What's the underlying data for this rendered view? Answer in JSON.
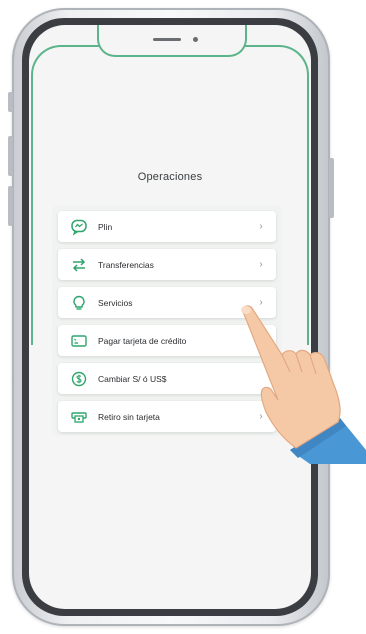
{
  "screen": {
    "title": "Operaciones"
  },
  "menu": {
    "items": [
      {
        "label": "Plin",
        "icon": "plin-chat-icon",
        "has_chevron": true
      },
      {
        "label": "Transferencias",
        "icon": "transfer-arrows-icon",
        "has_chevron": true
      },
      {
        "label": "Servicios",
        "icon": "lightbulb-icon",
        "has_chevron": true
      },
      {
        "label": "Pagar tarjeta de crédito",
        "icon": "credit-card-icon",
        "has_chevron": false
      },
      {
        "label": "Cambiar S/ ó US$",
        "icon": "currency-exchange-icon",
        "has_chevron": false
      },
      {
        "label": "Retiro sin tarjeta",
        "icon": "cash-withdraw-icon",
        "has_chevron": true
      }
    ]
  },
  "colors": {
    "accent": "#2fa56d",
    "screen_background": "#f4f5f4",
    "card_background": "#ffffff",
    "sleeve": "#4a97d6",
    "skin": "#f6c9a6"
  },
  "chevron_glyph": "›"
}
